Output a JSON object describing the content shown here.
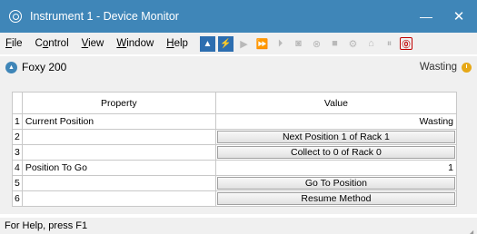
{
  "window": {
    "title": "Instrument 1 - Device Monitor",
    "minimize": "—",
    "close": "✕"
  },
  "menu": {
    "items": [
      {
        "accel": "F",
        "rest": "ile"
      },
      {
        "pre": "C",
        "accel": "o",
        "rest": "ntrol"
      },
      {
        "accel": "V",
        "rest": "iew"
      },
      {
        "accel": "W",
        "rest": "indow"
      },
      {
        "accel": "H",
        "rest": "elp"
      }
    ]
  },
  "toolbar": {
    "icons": [
      "mode-a-icon",
      "mode-b-icon",
      "play-icon",
      "fast-forward-icon",
      "step-icon",
      "camera-icon",
      "cancel-icon",
      "stop-icon",
      "tools-icon",
      "rack-icon",
      "pause-icon",
      "abort-icon"
    ],
    "stop_glyph": "⓪"
  },
  "device": {
    "name": "Foxy 200",
    "status": "Wasting",
    "status_color": "#e6a817"
  },
  "grid": {
    "headers": {
      "property": "Property",
      "value": "Value"
    },
    "rows": [
      {
        "index": "1",
        "property": "Current Position",
        "value": "Wasting",
        "kind": "text"
      },
      {
        "index": "2",
        "property": "",
        "value": "Next Position 1 of Rack 1",
        "kind": "button"
      },
      {
        "index": "3",
        "property": "",
        "value": "Collect to 0 of Rack 0",
        "kind": "button"
      },
      {
        "index": "4",
        "property": "Position To Go",
        "value": "1",
        "kind": "text"
      },
      {
        "index": "5",
        "property": "",
        "value": "Go To Position",
        "kind": "button"
      },
      {
        "index": "6",
        "property": "",
        "value": "Resume Method",
        "kind": "button"
      }
    ]
  },
  "statusbar": {
    "text": "For Help, press F1"
  }
}
